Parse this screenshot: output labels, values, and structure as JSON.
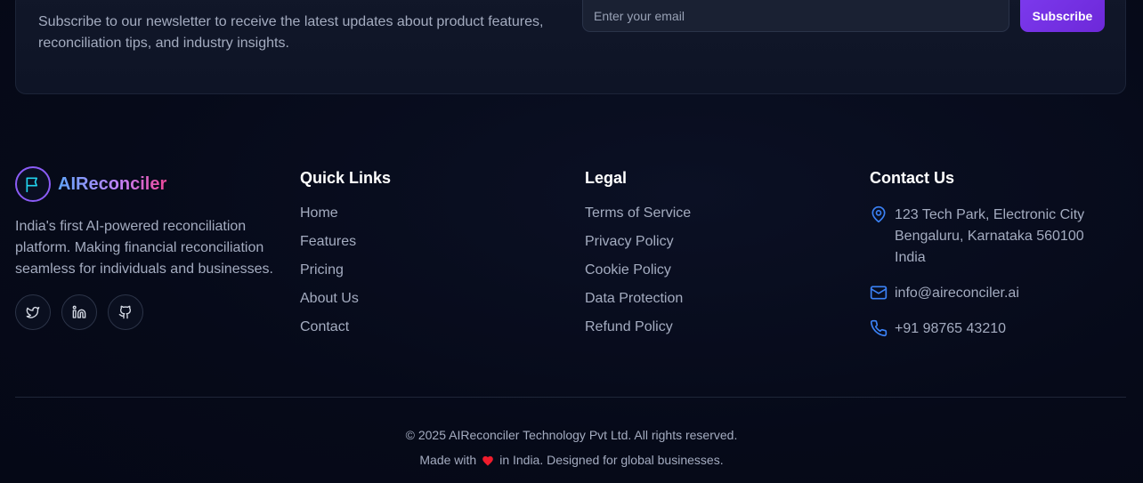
{
  "newsletter": {
    "text": "Subscribe to our newsletter to receive the latest updates about product features, reconciliation tips, and industry insights.",
    "email_placeholder": "Enter your email",
    "subscribe_label": "Subscribe"
  },
  "brand": {
    "name": "AIReconciler",
    "description": "India's first AI-powered reconciliation platform. Making financial reconciliation seamless for individuals and businesses.",
    "logo_icon": "flag-icon",
    "social": [
      {
        "icon": "twitter-icon"
      },
      {
        "icon": "linkedin-icon"
      },
      {
        "icon": "github-icon"
      }
    ]
  },
  "quick_links": {
    "title": "Quick Links",
    "items": [
      "Home",
      "Features",
      "Pricing",
      "About Us",
      "Contact"
    ]
  },
  "legal": {
    "title": "Legal",
    "items": [
      "Terms of Service",
      "Privacy Policy",
      "Cookie Policy",
      "Data Protection",
      "Refund Policy"
    ]
  },
  "contact": {
    "title": "Contact Us",
    "address_line1": "123 Tech Park, Electronic City",
    "address_line2": "Bengaluru, Karnataka 560100",
    "address_line3": "India",
    "email": "info@aireconciler.ai",
    "phone": "+91 98765 43210"
  },
  "footer": {
    "copyright": "© 2025 AIReconciler Technology Pvt Ltd. All rights reserved.",
    "made_prefix": "Made with",
    "made_suffix": "in India. Designed for global businesses."
  },
  "colors": {
    "accent": "#7c3aed",
    "icon_blue": "#3b82f6",
    "heart": "#ef1c2c"
  }
}
